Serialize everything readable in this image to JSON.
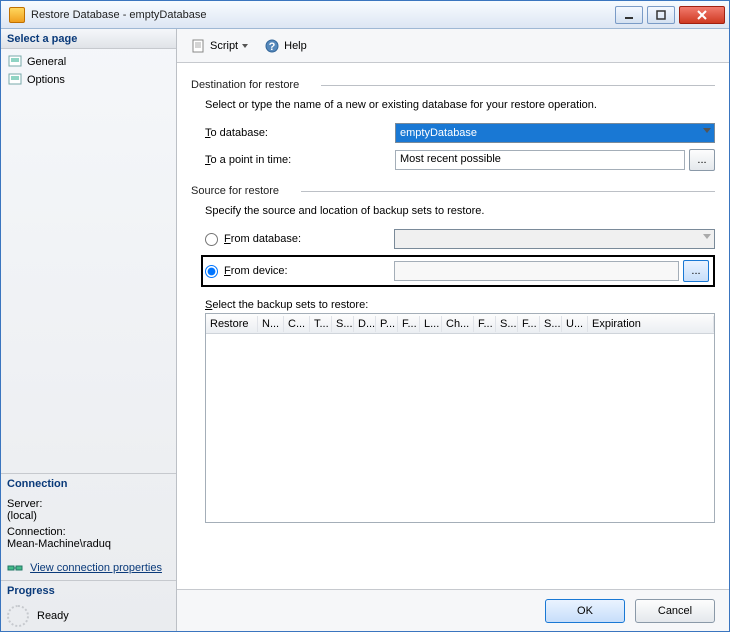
{
  "window": {
    "title": "Restore Database - emptyDatabase"
  },
  "sidebar": {
    "select_page": "Select a page",
    "pages": [
      {
        "label": "General"
      },
      {
        "label": "Options"
      }
    ],
    "connection_header": "Connection",
    "server_label": "Server:",
    "server_value": "(local)",
    "connection_label": "Connection:",
    "connection_value": "Mean-Machine\\raduq",
    "view_conn_props": "View connection properties",
    "progress_header": "Progress",
    "progress_status": "Ready"
  },
  "toolbar": {
    "script": "Script",
    "help": "Help"
  },
  "dest": {
    "group": "Destination for restore",
    "desc": "Select or type the name of a new or existing database for your restore operation.",
    "to_db_label_pre": "T",
    "to_db_label_rest": "o database:",
    "to_db_value": "emptyDatabase",
    "to_pit_label_pre": "T",
    "to_pit_label_rest": "o a point in time:",
    "to_pit_value": "Most recent possible"
  },
  "source": {
    "group": "Source for restore",
    "desc": "Specify the source and location of backup sets to restore.",
    "from_db_pre": "F",
    "from_db_rest": "rom database:",
    "from_dev_pre": "F",
    "from_dev_rest": "rom device:"
  },
  "grid": {
    "label_pre": "S",
    "label_rest": "elect the backup sets to restore:",
    "cols": [
      "Restore",
      "N...",
      "C...",
      "T...",
      "S...",
      "D...",
      "P...",
      "F...",
      "L...",
      "Ch...",
      "F...",
      "S...",
      "F...",
      "S...",
      "U...",
      "Expiration"
    ]
  },
  "footer": {
    "ok": "OK",
    "cancel": "Cancel"
  }
}
